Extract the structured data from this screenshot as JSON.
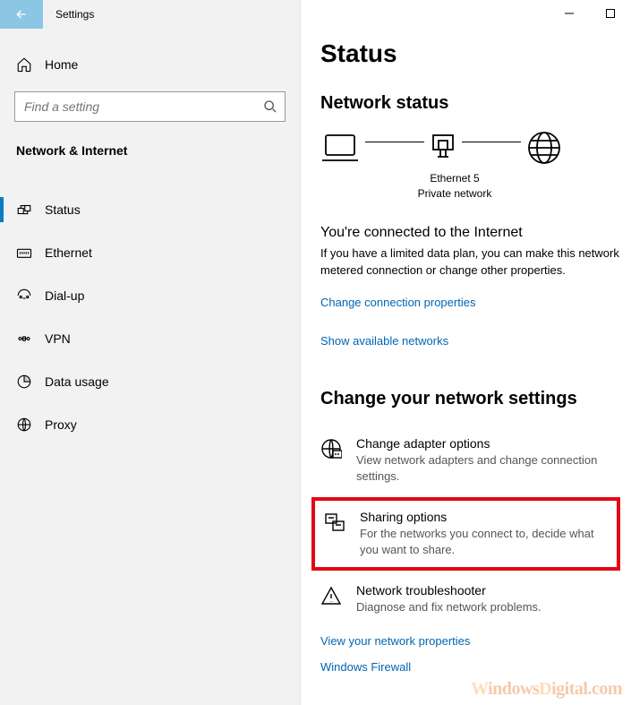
{
  "app_title": "Settings",
  "sidebar": {
    "home": "Home",
    "search_placeholder": "Find a setting",
    "section": "Network & Internet",
    "items": [
      {
        "label": "Status",
        "icon": "status"
      },
      {
        "label": "Ethernet",
        "icon": "ethernet"
      },
      {
        "label": "Dial-up",
        "icon": "dialup"
      },
      {
        "label": "VPN",
        "icon": "vpn"
      },
      {
        "label": "Data usage",
        "icon": "datausage"
      },
      {
        "label": "Proxy",
        "icon": "proxy"
      }
    ],
    "active_index": 0
  },
  "main": {
    "title": "Status",
    "section1": "Network status",
    "diagram": {
      "name": "Ethernet 5",
      "type": "Private network"
    },
    "connected_title": "You're connected to the Internet",
    "connected_body": "If you have a limited data plan, you can make this network metered connection or change other properties.",
    "link_change_props": "Change connection properties",
    "link_show_networks": "Show available networks",
    "section2": "Change your network settings",
    "rows": [
      {
        "title": "Change adapter options",
        "desc": "View network adapters and change connection settings.",
        "icon": "adapter"
      },
      {
        "title": "Sharing options",
        "desc": "For the networks you connect to, decide what you want to share.",
        "icon": "sharing",
        "highlighted": true
      },
      {
        "title": "Network troubleshooter",
        "desc": "Diagnose and fix network problems.",
        "icon": "troubleshoot"
      }
    ],
    "link_props": "View your network properties",
    "link_firewall": "Windows Firewall"
  },
  "watermark": "WindowsDigital.com"
}
